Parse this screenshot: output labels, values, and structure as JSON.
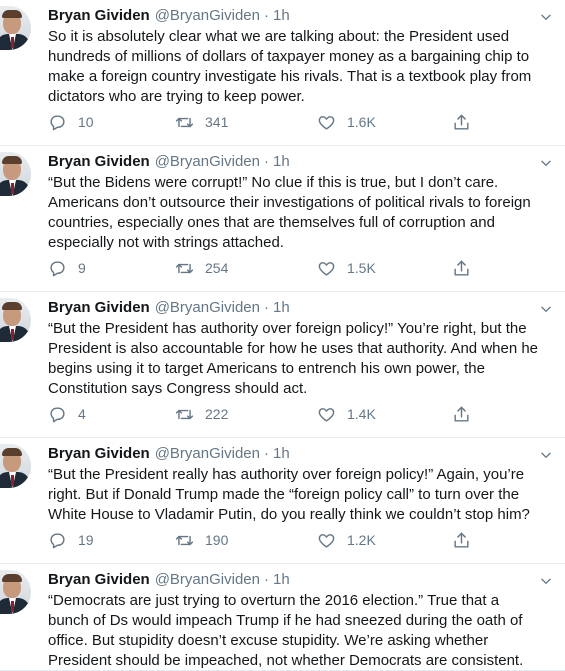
{
  "tweets": [
    {
      "name": "Bryan Gividen",
      "handle": "@BryanGividen",
      "dot": "·",
      "time": "1h",
      "lines": [
        "So it is absolutely clear what we are talking about: the President used",
        "hundreds of millions of dollars of taxpayer money as a bargaining chip to",
        "make a foreign country investigate his rivals. That is a textbook play from",
        "dictators who are trying to keep power."
      ],
      "replies": "10",
      "retweets": "341",
      "likes": "1.6K"
    },
    {
      "name": "Bryan Gividen",
      "handle": "@BryanGividen",
      "dot": "·",
      "time": "1h",
      "lines": [
        "“But the Bidens were corrupt!” No clue if this is true, but I don’t care.",
        "Americans don’t outsource their investigations of political rivals to foreign",
        "countries, especially ones that are themselves full of corruption and",
        "especially not with strings attached."
      ],
      "replies": "9",
      "retweets": "254",
      "likes": "1.5K"
    },
    {
      "name": "Bryan Gividen",
      "handle": "@BryanGividen",
      "dot": "·",
      "time": "1h",
      "lines": [
        "“But the President has authority over foreign policy!” You’re right, but the",
        "President is also accountable for how he uses that authority. And when he",
        "begins using it to target Americans to entrench his own power, the",
        "Constitution says Congress should act."
      ],
      "replies": "4",
      "retweets": "222",
      "likes": "1.4K"
    },
    {
      "name": "Bryan Gividen",
      "handle": "@BryanGividen",
      "dot": "·",
      "time": "1h",
      "lines": [
        "“But the President really has authority over foreign policy!” Again, you’re",
        "right. But if Donald Trump made the “foreign policy call” to turn over the",
        "White House to Vladamir Putin, do you really think we couldn’t stop him?"
      ],
      "replies": "19",
      "retweets": "190",
      "likes": "1.2K"
    },
    {
      "name": "Bryan Gividen",
      "handle": "@BryanGividen",
      "dot": "·",
      "time": "1h",
      "lines": [
        "“Democrats are just trying to overturn the 2016 election.” True that a",
        "bunch of Ds would impeach Trump if he had sneezed during the oath of",
        "office. But stupidity doesn’t excuse stupidity. We’re asking whether",
        "President should be impeached, not whether Democrats are consistent."
      ],
      "replies": "",
      "retweets": "",
      "likes": ""
    }
  ],
  "icons": {
    "reply": "reply-icon",
    "retweet": "retweet-icon",
    "like": "like-icon",
    "share": "share-icon",
    "caret": "chevron-down-icon"
  },
  "colors": {
    "text": "#14171a",
    "secondary": "#657786",
    "divider": "#e6ecf0"
  }
}
